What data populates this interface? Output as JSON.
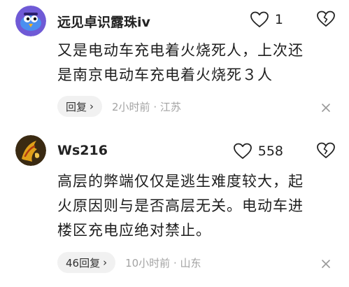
{
  "comments": [
    {
      "username": "远见卓识露珠iv",
      "like_count": "1",
      "lines": [
        "又是电动车充电着火烧死人，上次还",
        "是南京电动车充电着火烧死３人"
      ],
      "reply_label": "回复",
      "time_location": "2小时前 · 江苏"
    },
    {
      "username": "Ws216",
      "like_count": "558",
      "lines": [
        "高层的弊端仅仅是逃生难度较大，起",
        "火原因则与是否高层无关。电动车进",
        "楼区充电应绝对禁止。"
      ],
      "reply_label": "46回复",
      "time_location": "10小时前 · 山东"
    }
  ],
  "icons": {
    "like": "heart-outline-icon",
    "dislike": "broken-heart-icon",
    "reply_chevron": "chevron-right-icon",
    "close": "close-icon"
  },
  "colors": {
    "avatar1_bg": "#6f5ad6",
    "avatar2_bg": "#3a2a12",
    "meta_gray": "#a3a3a3",
    "pill_bg": "#f1f1f1"
  }
}
